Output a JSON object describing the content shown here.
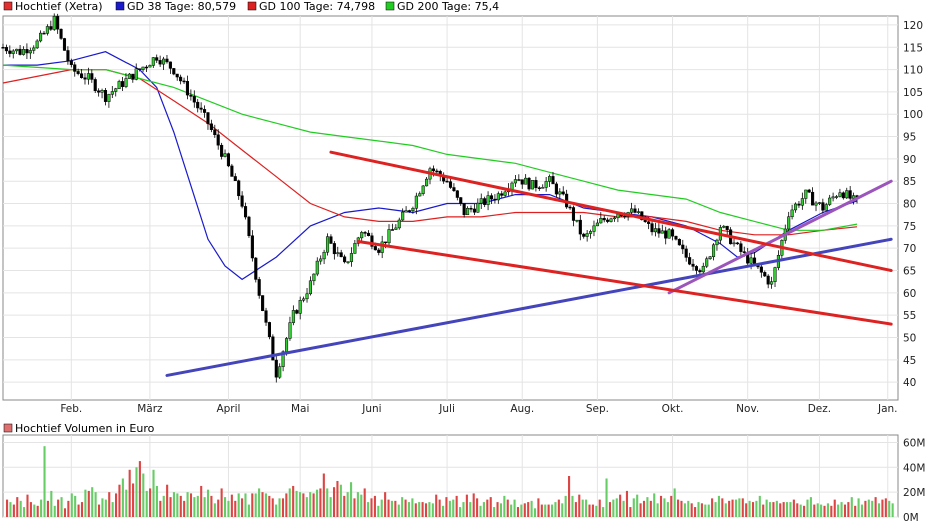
{
  "legend_price": [
    {
      "label": "Hochtief (Xetra)",
      "color": "#e03030"
    },
    {
      "label": "GD 38 Tage: 80,579",
      "color": "#1a1acc"
    },
    {
      "label": "GD 100 Tage: 74,798",
      "color": "#dd2020"
    },
    {
      "label": "GD 200 Tage: 75,4",
      "color": "#22cc22"
    }
  ],
  "legend_volume": {
    "label": "Hochtief Volumen in Euro",
    "color": "#e07070"
  },
  "chart_data": [
    {
      "type": "candlestick",
      "title": "",
      "x_tick_labels": [
        "Feb.",
        "März",
        "April",
        "Mai",
        "Juni",
        "Juli",
        "Aug.",
        "Sep.",
        "Okt.",
        "Nov.",
        "Dez.",
        "Jan."
      ],
      "y_ticks": [
        40,
        45,
        50,
        55,
        60,
        65,
        70,
        75,
        80,
        85,
        90,
        95,
        100,
        105,
        110,
        115,
        120
      ],
      "ylim": [
        36,
        122
      ],
      "grid": true,
      "series": [
        {
          "name": "Hochtief (Xetra)",
          "color": "#000000",
          "x": [
            0,
            5,
            10,
            15,
            20,
            25,
            30,
            35,
            40,
            45,
            50,
            55,
            60,
            65,
            70,
            75,
            80,
            85,
            90,
            95,
            100,
            105,
            110,
            115,
            120,
            125,
            130,
            135,
            140,
            145,
            150,
            155,
            160,
            165,
            170,
            175,
            180,
            185,
            190,
            195,
            200,
            205,
            210,
            215,
            220,
            225,
            230,
            235,
            240,
            245,
            250
          ],
          "values": [
            115,
            114,
            116,
            121,
            110,
            108,
            104,
            107,
            110,
            113,
            110,
            104,
            98,
            90,
            80,
            60,
            42,
            55,
            62,
            72,
            66,
            74,
            70,
            75,
            80,
            88,
            85,
            78,
            80,
            82,
            86,
            84,
            85,
            80,
            72,
            76,
            78,
            78,
            74,
            73,
            68,
            65,
            75,
            70,
            66,
            62,
            78,
            82,
            79,
            83,
            80
          ]
        },
        {
          "name": "GD 38 Tage: 80,579",
          "color": "#1a1acc",
          "x": [
            0,
            10,
            20,
            30,
            40,
            45,
            50,
            55,
            60,
            65,
            70,
            80,
            90,
            100,
            110,
            120,
            130,
            140,
            150,
            160,
            170,
            180,
            190,
            200,
            210,
            215,
            220,
            230,
            240,
            250
          ],
          "values": [
            111,
            111,
            112,
            114,
            110,
            106,
            96,
            84,
            72,
            66,
            63,
            68,
            75,
            78,
            79,
            78,
            80,
            80,
            82,
            82,
            79,
            78,
            77,
            75,
            71,
            68,
            69,
            74,
            78,
            80.579
          ]
        },
        {
          "name": "GD 100 Tage: 74,798",
          "color": "#dd2020",
          "x": [
            0,
            20,
            30,
            40,
            50,
            60,
            70,
            80,
            90,
            100,
            110,
            120,
            130,
            140,
            150,
            160,
            170,
            180,
            190,
            200,
            210,
            220,
            230,
            240,
            250
          ],
          "values": [
            107,
            110,
            110,
            108,
            103,
            98,
            92,
            86,
            80,
            77,
            76,
            76,
            77,
            77,
            78,
            78,
            78,
            77,
            77,
            76,
            74,
            73,
            73,
            74,
            74.798
          ]
        },
        {
          "name": "GD 200 Tage: 75,4",
          "color": "#22cc22",
          "x": [
            0,
            20,
            30,
            40,
            50,
            60,
            70,
            80,
            90,
            100,
            110,
            120,
            130,
            140,
            150,
            160,
            170,
            180,
            190,
            200,
            210,
            220,
            230,
            240,
            250
          ],
          "values": [
            111,
            110,
            110,
            108,
            106,
            103,
            100,
            98,
            96,
            95,
            94,
            93,
            91,
            90,
            89,
            87,
            85,
            83,
            82,
            81,
            78,
            76,
            74,
            74,
            75.4
          ]
        }
      ],
      "trendlines": [
        {
          "color": "#4444bb",
          "points": [
            [
              48,
              41.5
            ],
            [
              260,
              72
            ]
          ]
        },
        {
          "color": "#9b55bb",
          "points": [
            [
              195,
              60
            ],
            [
              260,
              85
            ]
          ]
        },
        {
          "color": "#dd2222",
          "points": [
            [
              96,
              91.5
            ],
            [
              260,
              65
            ]
          ]
        },
        {
          "color": "#dd2222",
          "points": [
            [
              104,
              71.5
            ],
            [
              260,
              53
            ]
          ]
        }
      ]
    },
    {
      "type": "bar",
      "title": "",
      "y_tick_labels": [
        "60M",
        "40M",
        "20M",
        "0M"
      ],
      "y_ticks": [
        60,
        40,
        20,
        0
      ],
      "ylim": [
        0,
        66
      ],
      "series": [
        {
          "name": "Hochtief Volumen in Euro",
          "color": "#e07070",
          "values": [
            14,
            12,
            10,
            16,
            13,
            8,
            18,
            12,
            10,
            9,
            14,
            57,
            13,
            21,
            9,
            14,
            16,
            7,
            13,
            19,
            17,
            10,
            12,
            22,
            21,
            24,
            20,
            10,
            15,
            14,
            20,
            12,
            19,
            26,
            31,
            22,
            38,
            27,
            40,
            45,
            35,
            21,
            23,
            38,
            25,
            13,
            17,
            26,
            16,
            20,
            19,
            17,
            13,
            20,
            19,
            16,
            17,
            25,
            16,
            22,
            17,
            11,
            14,
            23,
            16,
            13,
            18,
            13,
            19,
            15,
            19,
            10,
            19,
            19,
            23,
            20,
            19,
            17,
            15,
            10,
            15,
            15,
            19,
            23,
            25,
            21,
            20,
            19,
            16,
            20,
            19,
            22,
            23,
            35,
            23,
            16,
            24,
            29,
            26,
            17,
            20,
            28,
            15,
            20,
            18,
            23,
            12,
            15,
            17,
            9,
            14,
            20,
            14,
            13,
            13,
            10,
            16,
            14,
            12,
            15,
            11,
            12,
            12,
            11,
            12,
            11,
            18,
            14,
            9,
            16,
            13,
            14,
            17,
            8,
            12,
            18,
            12,
            19,
            15,
            9,
            12,
            14,
            16,
            8,
            12,
            11,
            17,
            14,
            10,
            14,
            8,
            10,
            11,
            12,
            13,
            7,
            15,
            10,
            10,
            10,
            10,
            12,
            14,
            11,
            17,
            33,
            17,
            12,
            18,
            14,
            14,
            10,
            10,
            9,
            14,
            8,
            31,
            12,
            14,
            15,
            18,
            13,
            21,
            8,
            15,
            18,
            11,
            13,
            16,
            13,
            19,
            11,
            17,
            15,
            12,
            17,
            23,
            14,
            13,
            11,
            13,
            11,
            8,
            12,
            11,
            10,
            10,
            15,
            12,
            17,
            15,
            11,
            13,
            14,
            14,
            15,
            15,
            11,
            13,
            12,
            13,
            17,
            10,
            14,
            12,
            12,
            13,
            11,
            12,
            12,
            12,
            14,
            11,
            10,
            9,
            14,
            16,
            10,
            11,
            10,
            9,
            11,
            9,
            14,
            10,
            12,
            10,
            12,
            16,
            9,
            15,
            10,
            13,
            14,
            13,
            16,
            11,
            14,
            15,
            13,
            11
          ]
        }
      ]
    }
  ]
}
